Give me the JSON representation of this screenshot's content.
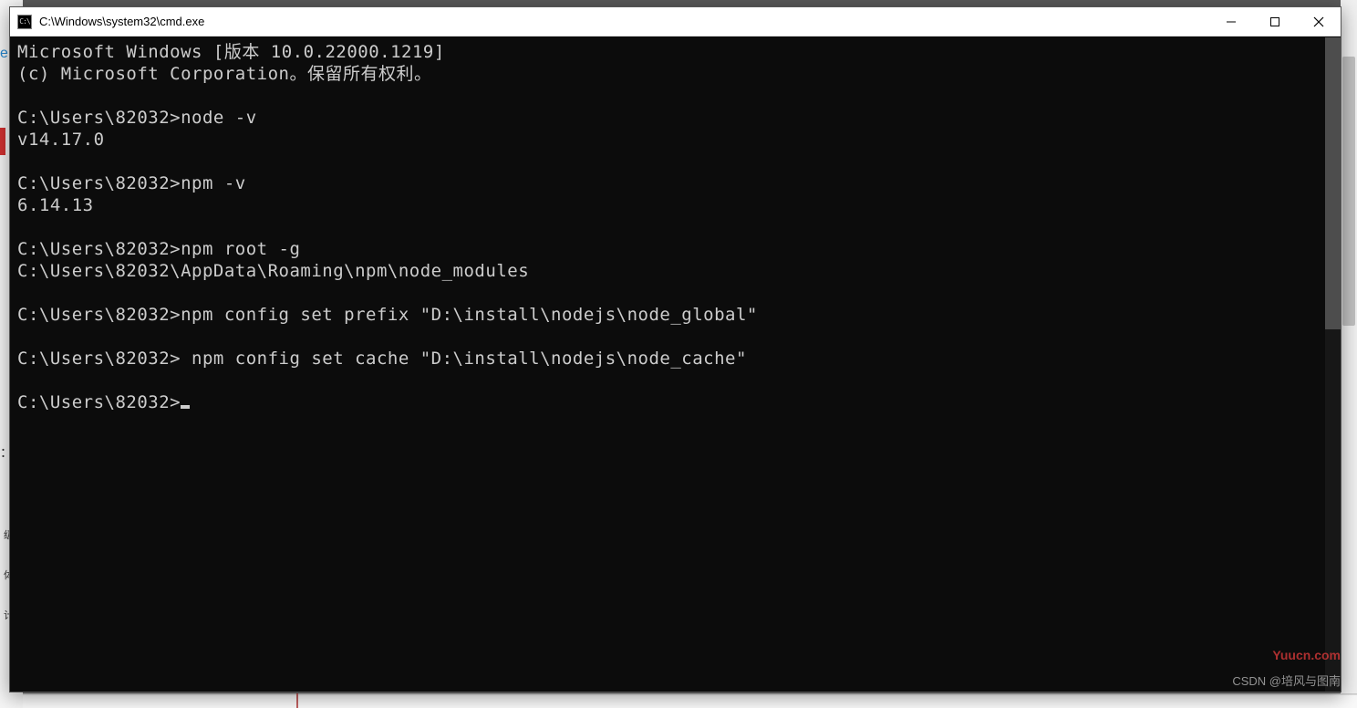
{
  "window": {
    "title": "C:\\Windows\\system32\\cmd.exe",
    "icon_label": "C:\\"
  },
  "terminal": {
    "lines": [
      "Microsoft Windows [版本 10.0.22000.1219]",
      "(c) Microsoft Corporation。保留所有权利。",
      "",
      "C:\\Users\\82032>node -v",
      "v14.17.0",
      "",
      "C:\\Users\\82032>npm -v",
      "6.14.13",
      "",
      "C:\\Users\\82032>npm root -g",
      "C:\\Users\\82032\\AppData\\Roaming\\npm\\node_modules",
      "",
      "C:\\Users\\82032>npm config set prefix \"D:\\install\\nodejs\\node_global\"",
      "",
      "C:\\Users\\82032> npm config set cache \"D:\\install\\nodejs\\node_cache\"",
      "",
      "C:\\Users\\82032>"
    ]
  },
  "background": {
    "left_labels": [
      "级",
      "体",
      "计"
    ],
    "e_label": "e",
    "colon": "："
  },
  "watermarks": {
    "yuucn": "Yuucn.com",
    "csdn": "CSDN @培风与图南"
  }
}
